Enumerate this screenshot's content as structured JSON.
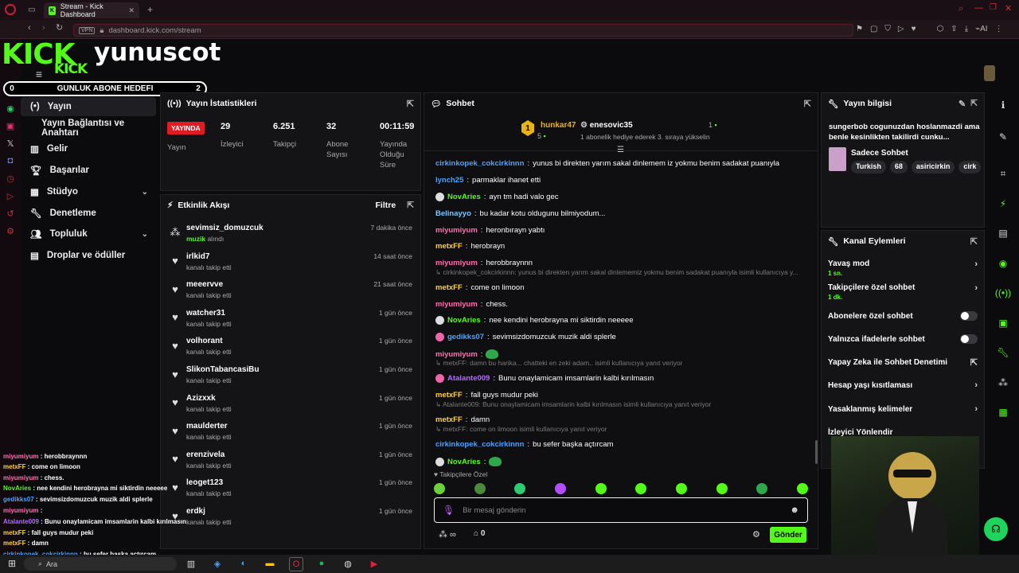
{
  "browser": {
    "tab_title": "Stream - Kick Dashboard",
    "url": "dashboard.kick.com/stream",
    "vpn": "VPN"
  },
  "overlay": {
    "logo": "KICK",
    "logo2": "KICK",
    "streamer": "yunuscot",
    "goal_label": "GUNLUK ABONE HEDEFI",
    "goal_left": "0",
    "goal_right": "2"
  },
  "nav": {
    "items": [
      {
        "label": "Yayın",
        "icon": "broadcast-icon"
      },
      {
        "label": "Yayın Bağlantısı ve Anahtarı"
      },
      {
        "label": "Gelir",
        "icon": "chart-icon"
      },
      {
        "label": "Başarılar",
        "icon": "trophy-icon"
      },
      {
        "label": "Stüdyo",
        "icon": "studio-icon",
        "chev": "⌄"
      },
      {
        "label": "Denetleme",
        "icon": "wrench-icon"
      },
      {
        "label": "Topluluk",
        "icon": "community-icon",
        "chev": "⌄"
      },
      {
        "label": "Droplar ve ödüller",
        "icon": "drops-icon"
      }
    ]
  },
  "stats": {
    "title": "Yayın İstatistikleri",
    "live": "YAYINDA",
    "live_label": "Yayın",
    "viewers": "29",
    "viewers_label": "İzleyici",
    "followers": "6.251",
    "followers_label": "Takipçi",
    "subs": "32",
    "subs_label": "Abone Sayısı",
    "uptime": "00:11:59",
    "uptime_label": "Yayında Olduğu Süre"
  },
  "activity": {
    "title": "Etkinlik Akışı",
    "filter": "Filtre",
    "items": [
      {
        "name": "sevimsiz_domuzcuk",
        "sub1": "muzik",
        "sub2": " alındı",
        "time": "7 dakika önce"
      },
      {
        "name": "irlkid7",
        "sub": "kanalı takip etti",
        "time": "14 saat önce"
      },
      {
        "name": "meeervve",
        "sub": "kanalı takip etti",
        "time": "21 saat önce"
      },
      {
        "name": "watcher31",
        "sub": "kanalı takip etti",
        "time": "1 gün önce"
      },
      {
        "name": "volhorant",
        "sub": "kanalı takip etti",
        "time": "1 gün önce"
      },
      {
        "name": "SlikonTabancasiBu",
        "sub": "kanalı takip etti",
        "time": "1 gün önce"
      },
      {
        "name": "Azizxxk",
        "sub": "kanalı takip etti",
        "time": "1 gün önce"
      },
      {
        "name": "maulderter",
        "sub": "kanalı takip etti",
        "time": "1 gün önce"
      },
      {
        "name": "erenzivela",
        "sub": "kanalı takip etti",
        "time": "1 gün önce"
      },
      {
        "name": "leoget123",
        "sub": "kanalı takip etti",
        "time": "1 gün önce"
      },
      {
        "name": "erdkj",
        "sub": "kanalı takip etti",
        "time": "1 gün önce"
      }
    ]
  },
  "chat": {
    "title": "Sohbet",
    "top1_rank": "1",
    "top1_name": "hunkar47",
    "top1_count": "5",
    "top2_name": "enesovic35",
    "top2_count": "1",
    "top2_sub": "1 abonelik hediye ederek 3. sıraya yükselin",
    "messages": [
      {
        "u": "cirkinkopek_cokcirkinnn",
        "c": "#4aa3ff",
        "t": "yunus bi direkten yarım sakal dinlemem iz yokmu benim sadakat puanıyla"
      },
      {
        "u": "lynch25",
        "c": "#4aa3ff",
        "t": "parmaklar ihanet etti"
      },
      {
        "u": "NovAries",
        "c": "#53fc18",
        "t": "ayn tm hadi valo gec"
      },
      {
        "u": "Belinayyo",
        "c": "#7ec8ff",
        "t": "bu kadar kotu oldugunu bilmiyodum..."
      },
      {
        "u": "miyumiyum",
        "c": "#ff6fb1",
        "t": "heronbırayn yabtı"
      },
      {
        "u": "metxFF",
        "c": "#ffd23f",
        "t": "herobrayn"
      },
      {
        "u": "miyumiyum",
        "c": "#ff6fb1",
        "t": "herobbraynnn"
      },
      {
        "u": "metxFF",
        "c": "#ffd23f",
        "t": "come on limoon"
      },
      {
        "u": "miyumiyum",
        "c": "#ff6fb1",
        "t": "chess."
      },
      {
        "u": "NovAries",
        "c": "#53fc18",
        "t": "nee kendini herobrayna mi siktirdin neeeee"
      },
      {
        "u": "gedikks07",
        "c": "#4aa3ff",
        "t": "sevimsizdomuzcuk muzik aldi splerle"
      },
      {
        "u": "miyumiyum",
        "c": "#ff6fb1",
        "t": ""
      },
      {
        "u": "Atalante009",
        "c": "#b36bff",
        "t": "Bunu onaylamicam imsamlarin kalbi kırılmasın"
      },
      {
        "u": "metxFF",
        "c": "#ffd23f",
        "t": "fall guys mudur peki"
      },
      {
        "u": "metxFF",
        "c": "#ffd23f",
        "t": "damn"
      },
      {
        "u": "cirkinkopek_cokcirkinnn",
        "c": "#4aa3ff",
        "t": "bu sefer başka açtırcam"
      },
      {
        "u": "NovAries",
        "c": "#53fc18",
        "t": ""
      }
    ],
    "replies": [
      "cirkinkopek_cokcirkinnn: yunus bi direkten yarım sakal dinlememiz yokmu benim sadakat puanıyla isimli kullanıcıya y...",
      "metxFF: damn bu harika... chatteki en zeki adam.. isimli kullanıcıya yanıt veriyor",
      "Atalante009: Bunu onaylamicam imsamlarin kalbi kırılmasın isimli kullanıcıya yanıt veriyor",
      "metxFF: come on limoon isimli kullanıcıya yanıt veriyor"
    ],
    "followers_only": "Takipçilere Özel",
    "placeholder": "Bir mesaj gönderin",
    "points": "0",
    "send": "Gönder"
  },
  "info": {
    "title": "Yayın bilgisi",
    "stream_title": "sungerbob cogunuzdan hoslanmazdi ama benle kesinlikten takilirdi cunku...",
    "category": "Sadece Sohbet",
    "tags": [
      "Turkish",
      "68",
      "asiricirkin",
      "cirk"
    ]
  },
  "channel": {
    "title": "Kanal Eylemleri",
    "items": [
      {
        "label": "Yavaş mod",
        "sub": "1 sn.",
        "ctl": "chevron"
      },
      {
        "label": "Takipçilere özel sohbet",
        "sub": "1 dk.",
        "ctl": "chevron"
      },
      {
        "label": "Abonelere özel sohbet",
        "ctl": "toggle"
      },
      {
        "label": "Yalnızca ifadelerle sohbet",
        "ctl": "toggle"
      },
      {
        "label": "Yapay Zeka ile Sohbet Denetimi",
        "ctl": "external"
      },
      {
        "label": "Hesap yaşı kısıtlaması",
        "ctl": "chevron"
      },
      {
        "label": "Yasaklanmış kelimeler",
        "ctl": "chevron"
      },
      {
        "label": "İzleyici Yönlendir",
        "ctl": "none"
      }
    ]
  },
  "overlay_chat": [
    {
      "u": "miyumiyum",
      "c": "#ff6fb1",
      "t": " : herobbraynnn"
    },
    {
      "u": "metxFF",
      "c": "#ffd23f",
      "t": " : come on limoon"
    },
    {
      "u": "miyumiyum",
      "c": "#ff6fb1",
      "t": " : chess."
    },
    {
      "u": "NovAries",
      "c": "#53fc18",
      "t": " : nee kendini herobrayna mi siktirdin neeeee"
    },
    {
      "u": "gedikks07",
      "c": "#4aa3ff",
      "t": " : sevimsizdomuzcuk muzik aldi splerle"
    },
    {
      "u": "miyumiyum",
      "c": "#ff6fb1",
      "t": " :"
    },
    {
      "u": "Atalante009",
      "c": "#b36bff",
      "t": " : Bunu onaylamicam imsamlarin kalbi kırılmasın"
    },
    {
      "u": "metxFF",
      "c": "#ffd23f",
      "t": " : fall guys mudur peki"
    },
    {
      "u": "metxFF",
      "c": "#ffd23f",
      "t": " : damn"
    },
    {
      "u": "cirkinkopek_cokcirkinnn",
      "c": "#4aa3ff",
      "t": " : bu sefer başka açtırcam"
    }
  ],
  "taskbar": {
    "search": "Ara"
  },
  "colors": {
    "accent": "#53fc18",
    "live": "#e01b24"
  }
}
